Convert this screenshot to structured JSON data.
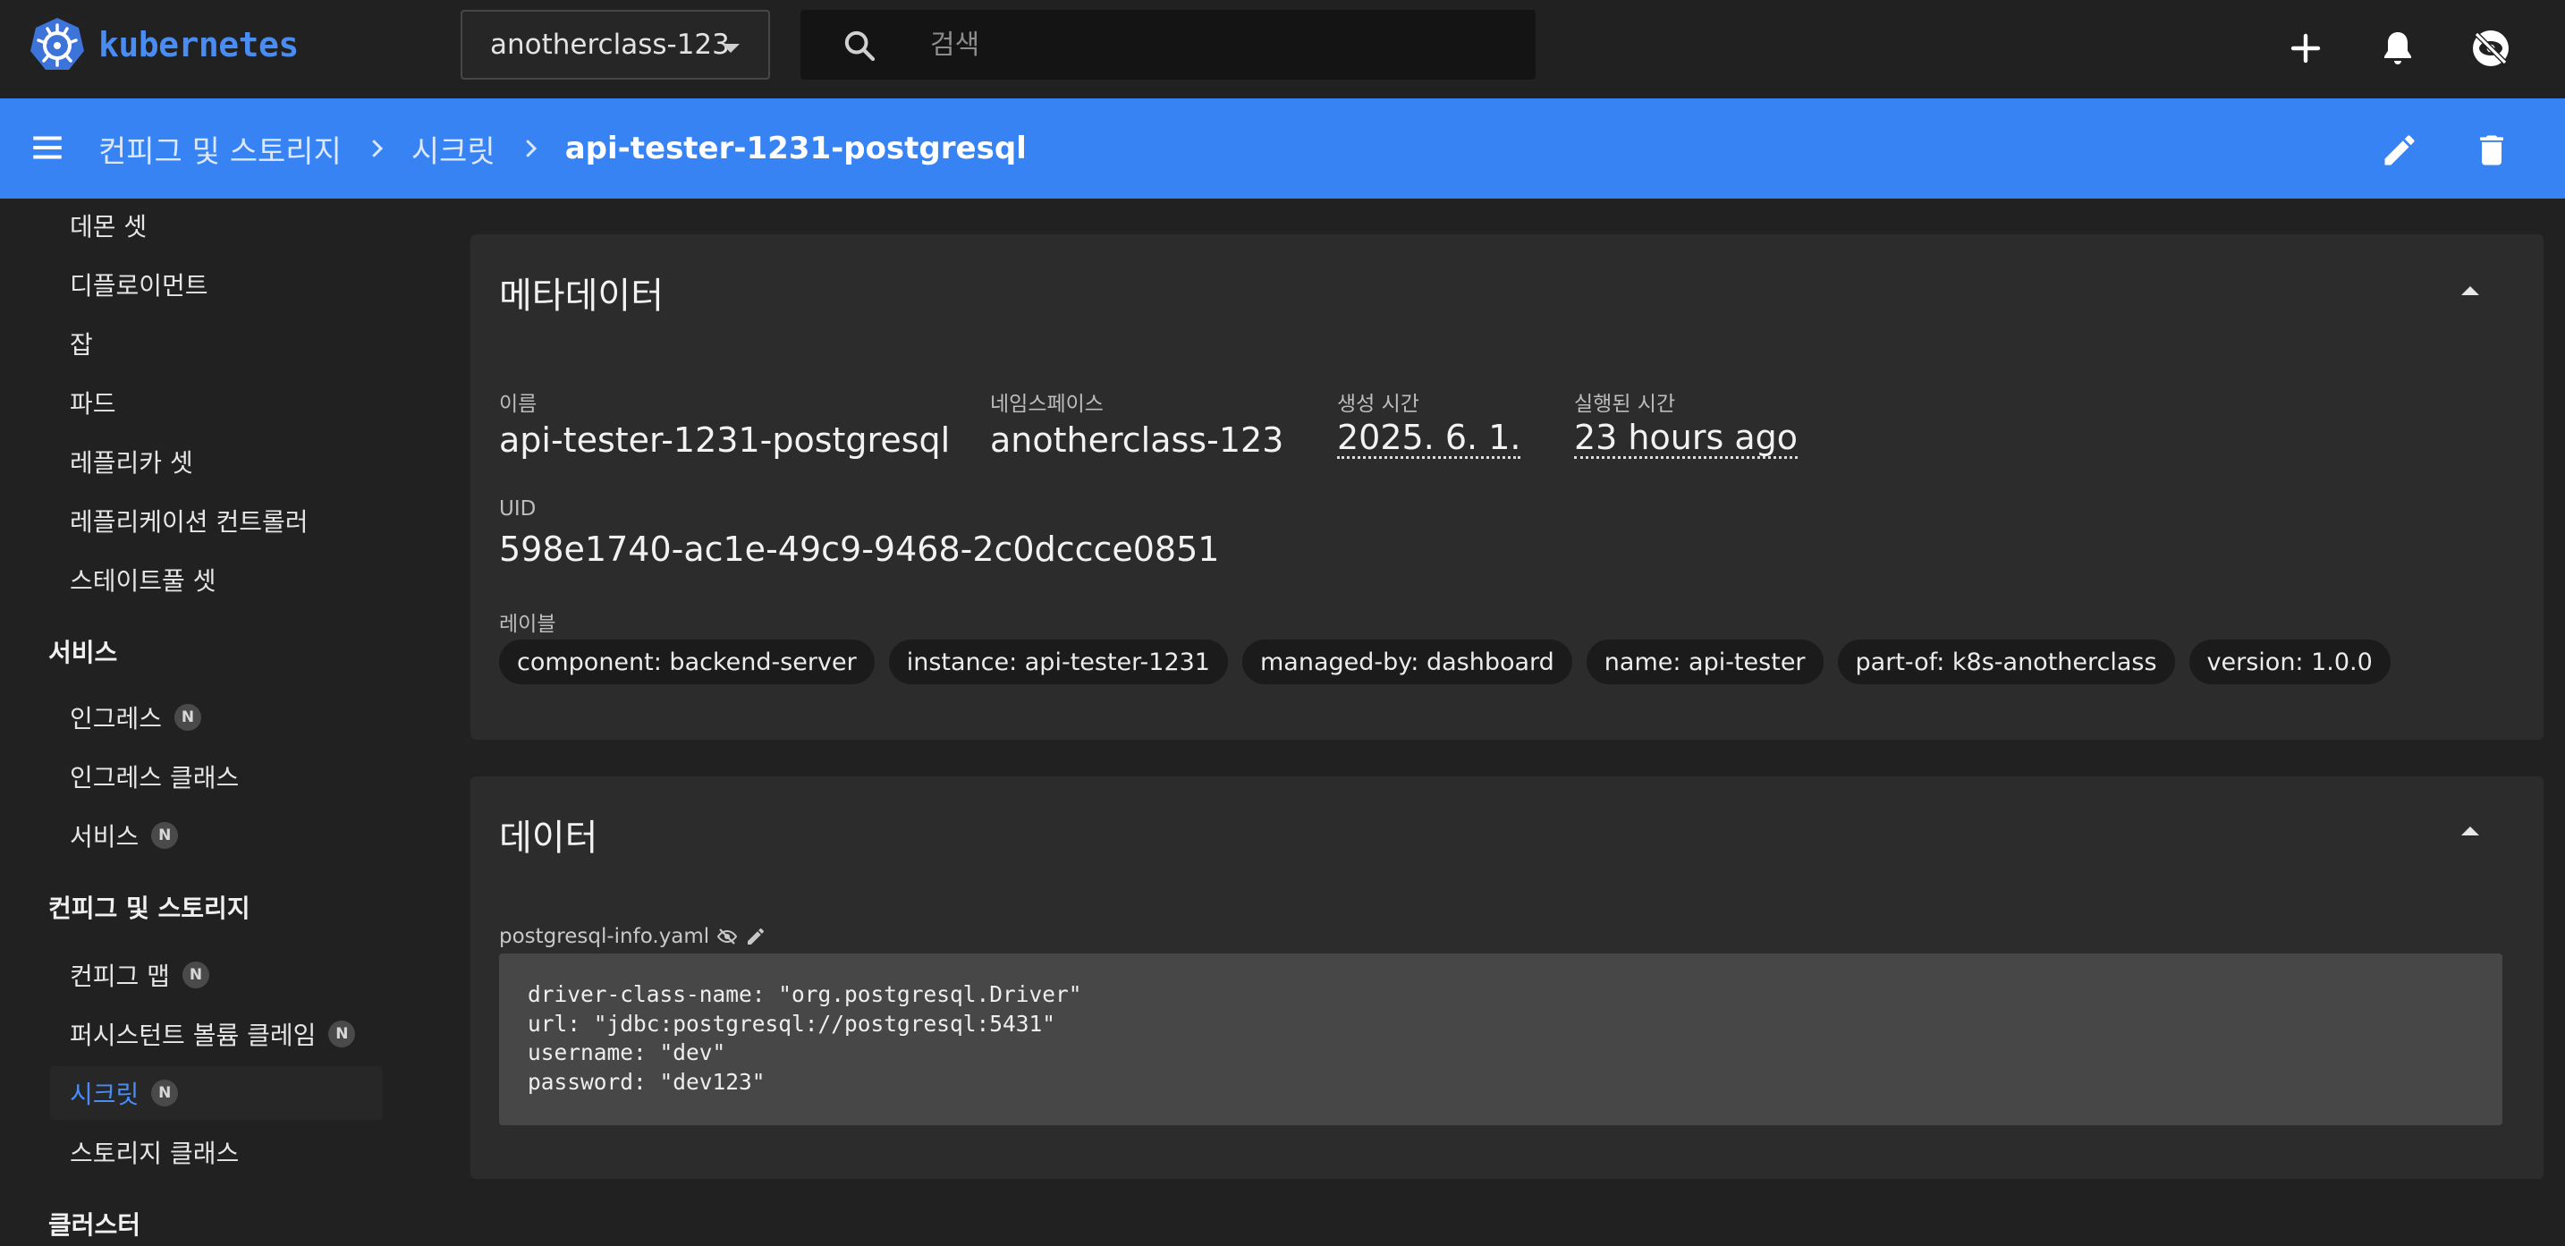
{
  "app": {
    "logo_text": "kubernetes"
  },
  "topbar": {
    "namespace": "anotherclass-123",
    "search_placeholder": "검색"
  },
  "breadcrumb": {
    "items": [
      "컨피그 및 스토리지",
      "시크릿"
    ],
    "current": "api-tester-1231-postgresql"
  },
  "sidebar": {
    "items": [
      {
        "label": "데몬 셋"
      },
      {
        "label": "디플로이먼트"
      },
      {
        "label": "잡"
      },
      {
        "label": "파드"
      },
      {
        "label": "레플리카 셋"
      },
      {
        "label": "레플리케이션 컨트롤러"
      },
      {
        "label": "스테이트풀 셋"
      }
    ],
    "groups": {
      "service": "서비스",
      "config": "컨피그 및 스토리지",
      "cluster": "클러스터"
    },
    "service_items": [
      {
        "label": "인그레스",
        "badge": "N"
      },
      {
        "label": "인그레스 클래스"
      },
      {
        "label": "서비스",
        "badge": "N"
      }
    ],
    "config_items": [
      {
        "label": "컨피그 맵",
        "badge": "N"
      },
      {
        "label": "퍼시스턴트 볼륨 클레임",
        "badge": "N"
      },
      {
        "label": "시크릿",
        "badge": "N",
        "active": true
      },
      {
        "label": "스토리지 클래스"
      }
    ]
  },
  "metadata": {
    "title": "메타데이터",
    "name_label": "이름",
    "name": "api-tester-1231-postgresql",
    "namespace_label": "네임스페이스",
    "namespace": "anotherclass-123",
    "created_label": "생성 시간",
    "created": "2025. 6. 1.",
    "age_label": "실행된 시간",
    "age": "23 hours ago",
    "uid_label": "UID",
    "uid": "598e1740-ac1e-49c9-9468-2c0dccce0851",
    "labels_label": "레이블",
    "labels": [
      "component: backend-server",
      "instance: api-tester-1231",
      "managed-by: dashboard",
      "name: api-tester",
      "part-of: k8s-anotherclass",
      "version: 1.0.0"
    ]
  },
  "data_section": {
    "title": "데이터",
    "key": "postgresql-info.yaml",
    "lines": [
      "driver-class-name: \"org.postgresql.Driver\"",
      "url: \"jdbc:postgresql://postgresql:5431\"",
      "username: \"dev\"",
      "password: \"dev123\""
    ]
  },
  "colors": {
    "accent": "#3883f3",
    "background": "#212121",
    "card": "#2c2c2c",
    "active_link": "#4a8df2"
  },
  "icons": [
    "kubernetes-logo",
    "search-icon",
    "plus-icon",
    "bell-icon",
    "eye-off-icon",
    "menu-icon",
    "chevron-right-icon",
    "pencil-icon",
    "trash-icon",
    "chevron-up-icon"
  ]
}
